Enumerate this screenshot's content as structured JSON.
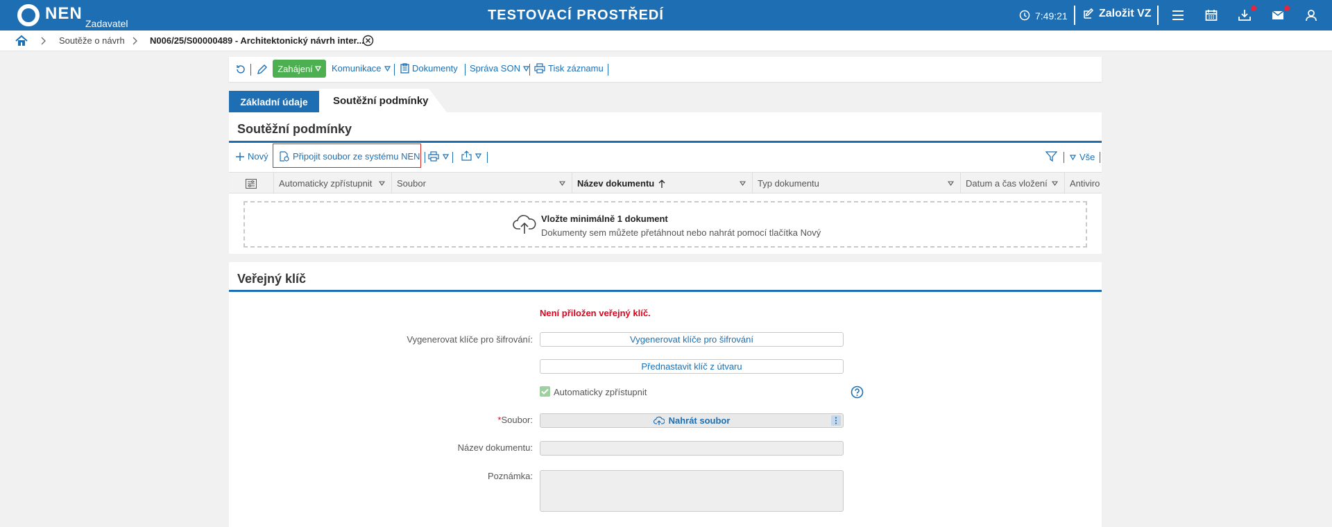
{
  "topbar": {
    "logo": "NEN",
    "role": "Zadavatel",
    "environment": "TESTOVACÍ PROSTŘEDÍ",
    "time": "7:49:21",
    "create_label": "Založit VZ",
    "icons": [
      "clock-icon",
      "edit-icon",
      "menu-icon",
      "calendar-icon",
      "download-icon",
      "mail-icon",
      "user-icon"
    ],
    "colors": {
      "bar": "#1e6eb3",
      "notification": "#e8243c"
    }
  },
  "breadcrumb": {
    "items": [
      "Soutěže o návrh",
      "N006/25/S00000489 - Architektonický návrh inter..."
    ]
  },
  "toolbar": {
    "start_label": "Zahájení",
    "communication_label": "Komunikace",
    "documents_label": "Dokumenty",
    "son_label": "Správa SON",
    "print_label": "Tisk záznamu",
    "colors": {
      "start": "#4caf50",
      "link": "#1a6fb5"
    }
  },
  "tabs": {
    "basic": "Základní údaje",
    "conditions": "Soutěžní podmínky"
  },
  "conditions_panel": {
    "title": "Soutěžní podmínky",
    "new_label": "Nový",
    "attach_label": "Připojit soubor ze systému NEN",
    "filter_all_label": "Vše",
    "columns": [
      "Automaticky zpřístupnit",
      "Soubor",
      "Název dokumentu",
      "Typ dokumentu",
      "Datum a čas vložení",
      "Antiviro"
    ],
    "dropzone_title": "Vložte minimálně 1 dokument",
    "dropzone_text": "Dokumenty sem můžete přetáhnout nebo nahrát pomocí tlačítka Nový"
  },
  "key_panel": {
    "title": "Veřejný klíč",
    "warning": "Není přiložen veřejný klíč.",
    "generate_label": "Vygenerovat klíče pro šifrování:",
    "generate_button": "Vygenerovat klíče pro šifrování",
    "preset_button": "Přednastavit klíč z útvaru",
    "auto_access_label": "Automaticky zpřístupnit",
    "file_label": "Soubor:",
    "required_mark": "*",
    "upload_button": "Nahrát soubor",
    "doc_name_label": "Název dokumentu:",
    "note_label": "Poznámka:",
    "colors": {
      "warning": "#e0001b",
      "accent": "#1e6eb3"
    }
  }
}
